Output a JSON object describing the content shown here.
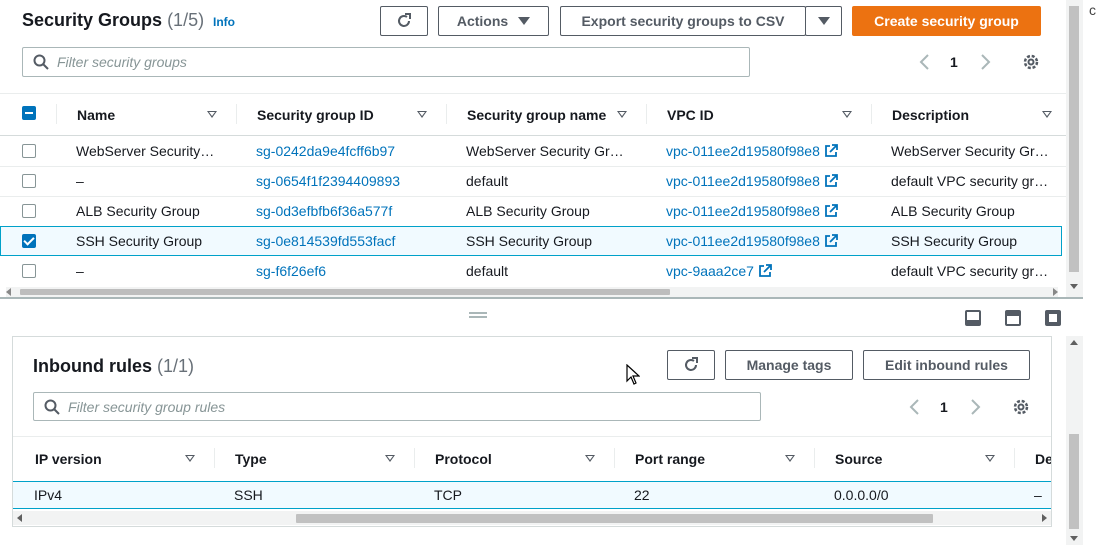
{
  "header": {
    "title": "Security Groups",
    "count": "(1/5)",
    "info": "Info",
    "actions_label": "Actions",
    "export_label": "Export security groups to CSV",
    "create_label": "Create security group",
    "search_placeholder": "Filter security groups",
    "page_number": "1"
  },
  "sg_table": {
    "columns": [
      "Name",
      "Security group ID",
      "Security group name",
      "VPC ID",
      "Description"
    ],
    "rows": [
      {
        "name": "WebServer Security…",
        "id": "sg-0242da9e4fcff6b97",
        "group_name": "WebServer Security Gr…",
        "vpc": "vpc-011ee2d19580f98e8",
        "desc": "WebServer Security Gr…",
        "selected": false
      },
      {
        "name": "–",
        "id": "sg-0654f1f2394409893",
        "group_name": "default",
        "vpc": "vpc-011ee2d19580f98e8",
        "desc": "default VPC security gr…",
        "selected": false
      },
      {
        "name": "ALB Security Group",
        "id": "sg-0d3efbfb6f36a577f",
        "group_name": "ALB Security Group",
        "vpc": "vpc-011ee2d19580f98e8",
        "desc": "ALB Security Group",
        "selected": false
      },
      {
        "name": "SSH Security Group",
        "id": "sg-0e814539fd553facf",
        "group_name": "SSH Security Group",
        "vpc": "vpc-011ee2d19580f98e8",
        "desc": "SSH Security Group",
        "selected": true
      },
      {
        "name": "–",
        "id": "sg-f6f26ef6",
        "group_name": "default",
        "vpc": "vpc-9aaa2ce7",
        "desc": "default VPC security gr…",
        "selected": false
      }
    ]
  },
  "inbound": {
    "title": "Inbound rules",
    "count": "(1/1)",
    "manage_tags_label": "Manage tags",
    "edit_label": "Edit inbound rules",
    "search_placeholder": "Filter security group rules",
    "page_number": "1",
    "columns": [
      "IP version",
      "Type",
      "Protocol",
      "Port range",
      "Source",
      "De"
    ],
    "rows": [
      {
        "ip_version": "IPv4",
        "type": "SSH",
        "protocol": "TCP",
        "port_range": "22",
        "source": "0.0.0.0/0",
        "desc": "–"
      }
    ]
  },
  "colors": {
    "accent": "#ec7211",
    "link": "#0073bb",
    "selected_row_bg": "#f1faff"
  }
}
